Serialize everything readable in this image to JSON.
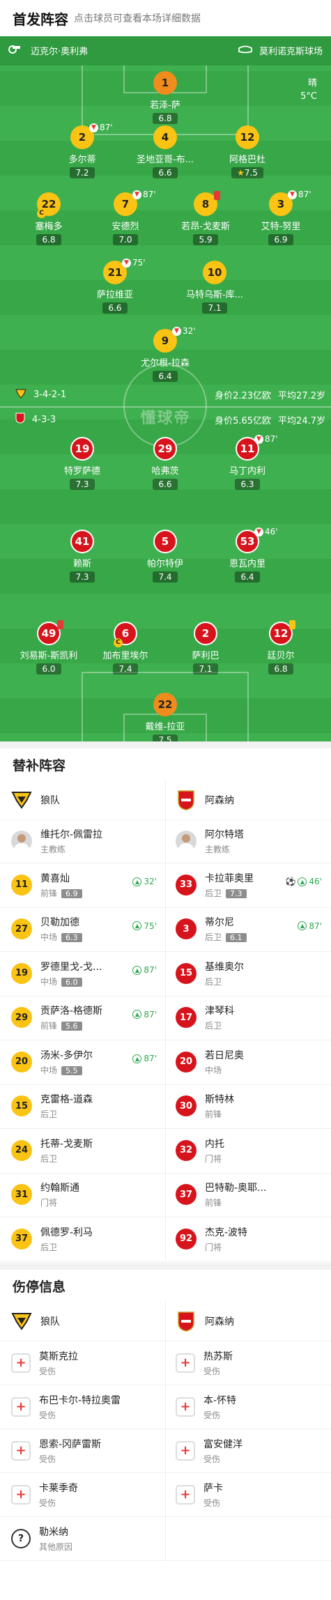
{
  "header": {
    "title": "首发阵容",
    "subtitle": "点击球员可查看本场详细数据"
  },
  "venue": {
    "referee": "迈克尔·奥利弗",
    "stadium": "莫利诺克斯球场"
  },
  "weather": {
    "condition": "晴",
    "temp": "5°C"
  },
  "home": {
    "formation": "3-4-2-1",
    "value": "身价2.23亿欧",
    "age": "平均27.2岁"
  },
  "away": {
    "formation": "4-3-3",
    "value": "身价5.65亿欧",
    "age": "平均24.7岁"
  },
  "watermark": "懂球帝",
  "home_players": [
    {
      "num": "1",
      "name": "若泽-萨",
      "rating": "6.8"
    },
    {
      "num": "2",
      "name": "多尔蒂",
      "rating": "7.2",
      "sub": "87'"
    },
    {
      "num": "4",
      "name": "圣地亚哥-布...",
      "rating": "6.6"
    },
    {
      "num": "12",
      "name": "阿格巴杜",
      "rating": "7.5"
    },
    {
      "num": "22",
      "name": "塞梅多",
      "rating": "6.8"
    },
    {
      "num": "7",
      "name": "安德烈",
      "rating": "7.0",
      "sub": "87'"
    },
    {
      "num": "8",
      "name": "若昂-戈麦斯",
      "rating": "5.9"
    },
    {
      "num": "3",
      "name": "艾特-努里",
      "rating": "6.9",
      "sub": "87'"
    },
    {
      "num": "21",
      "name": "萨拉维亚",
      "rating": "6.6",
      "sub": "75'"
    },
    {
      "num": "10",
      "name": "马特乌斯-库...",
      "rating": "7.1"
    },
    {
      "num": "9",
      "name": "尤尔根-拉森",
      "rating": "6.4",
      "sub": "32'"
    }
  ],
  "away_players": [
    {
      "num": "19",
      "name": "特罗萨德",
      "rating": "7.3"
    },
    {
      "num": "29",
      "name": "哈弗茨",
      "rating": "6.6"
    },
    {
      "num": "11",
      "name": "马丁内利",
      "rating": "6.3",
      "sub": "87'"
    },
    {
      "num": "41",
      "name": "赖斯",
      "rating": "7.3"
    },
    {
      "num": "5",
      "name": "帕尔特伊",
      "rating": "7.4"
    },
    {
      "num": "53",
      "name": "恩瓦内里",
      "rating": "6.4",
      "sub": "46'"
    },
    {
      "num": "49",
      "name": "刘易斯-斯凯利",
      "rating": "6.0"
    },
    {
      "num": "6",
      "name": "加布里埃尔",
      "rating": "7.4"
    },
    {
      "num": "2",
      "name": "萨利巴",
      "rating": "7.1"
    },
    {
      "num": "12",
      "name": "廷贝尔",
      "rating": "6.8"
    },
    {
      "num": "22",
      "name": "戴维-拉亚",
      "rating": "7.5"
    }
  ],
  "subs_title": "替补阵容",
  "subs": {
    "home_team": "狼队",
    "away_team": "阿森纳",
    "home_coach": {
      "name": "维托尔-佩雷拉",
      "role": "主教练"
    },
    "away_coach": {
      "name": "阿尔特塔",
      "role": "主教练"
    },
    "home": [
      {
        "num": "11",
        "name": "黄喜灿",
        "pos": "前锋",
        "rating": "6.9",
        "in": "32'"
      },
      {
        "num": "27",
        "name": "贝勒加德",
        "pos": "中场",
        "rating": "6.3",
        "in": "75'"
      },
      {
        "num": "19",
        "name": "罗德里戈-戈...",
        "pos": "中场",
        "rating": "6.0",
        "in": "87'"
      },
      {
        "num": "29",
        "name": "贡萨洛-格德斯",
        "pos": "前锋",
        "rating": "5.6",
        "in": "87'"
      },
      {
        "num": "20",
        "name": "汤米-多伊尔",
        "pos": "中场",
        "rating": "5.5",
        "in": "87'"
      },
      {
        "num": "15",
        "name": "克雷格-道森",
        "pos": "后卫"
      },
      {
        "num": "24",
        "name": "托蒂-戈麦斯",
        "pos": "后卫"
      },
      {
        "num": "31",
        "name": "约翰斯通",
        "pos": "门将"
      },
      {
        "num": "37",
        "name": "佩德罗-利马",
        "pos": "后卫"
      }
    ],
    "away": [
      {
        "num": "33",
        "name": "卡拉菲奥里",
        "pos": "后卫",
        "rating": "7.3",
        "in": "46'",
        "goal": true
      },
      {
        "num": "3",
        "name": "蒂尔尼",
        "pos": "后卫",
        "rating": "6.1",
        "in": "87'"
      },
      {
        "num": "15",
        "name": "基维奥尔",
        "pos": "后卫"
      },
      {
        "num": "17",
        "name": "津琴科",
        "pos": "后卫"
      },
      {
        "num": "20",
        "name": "若日尼奥",
        "pos": "中场"
      },
      {
        "num": "30",
        "name": "斯特林",
        "pos": "前锋"
      },
      {
        "num": "32",
        "name": "内托",
        "pos": "门将"
      },
      {
        "num": "37",
        "name": "巴特勒-奥耶...",
        "pos": "前锋"
      },
      {
        "num": "92",
        "name": "杰克-波特",
        "pos": "门将"
      }
    ]
  },
  "injury_title": "伤停信息",
  "injuries": {
    "home_team": "狼队",
    "away_team": "阿森纳",
    "home": [
      {
        "name": "莫斯克拉",
        "reason": "受伤"
      },
      {
        "name": "布巴卡尔-特拉奥雷",
        "reason": "受伤"
      },
      {
        "name": "恩索-冈萨雷斯",
        "reason": "受伤"
      },
      {
        "name": "卡莱季奇",
        "reason": "受伤"
      },
      {
        "name": "勒米纳",
        "reason": "其他原因",
        "other": true
      }
    ],
    "away": [
      {
        "name": "热苏斯",
        "reason": "受伤"
      },
      {
        "name": "本-怀特",
        "reason": "受伤"
      },
      {
        "name": "富安健洋",
        "reason": "受伤"
      },
      {
        "name": "萨卡",
        "reason": "受伤"
      }
    ]
  },
  "colors": {
    "pitch": "#3fb04f",
    "wolves": "#fbc313",
    "arsenal": "#d7141c",
    "sub_in": "#2fa84f"
  }
}
